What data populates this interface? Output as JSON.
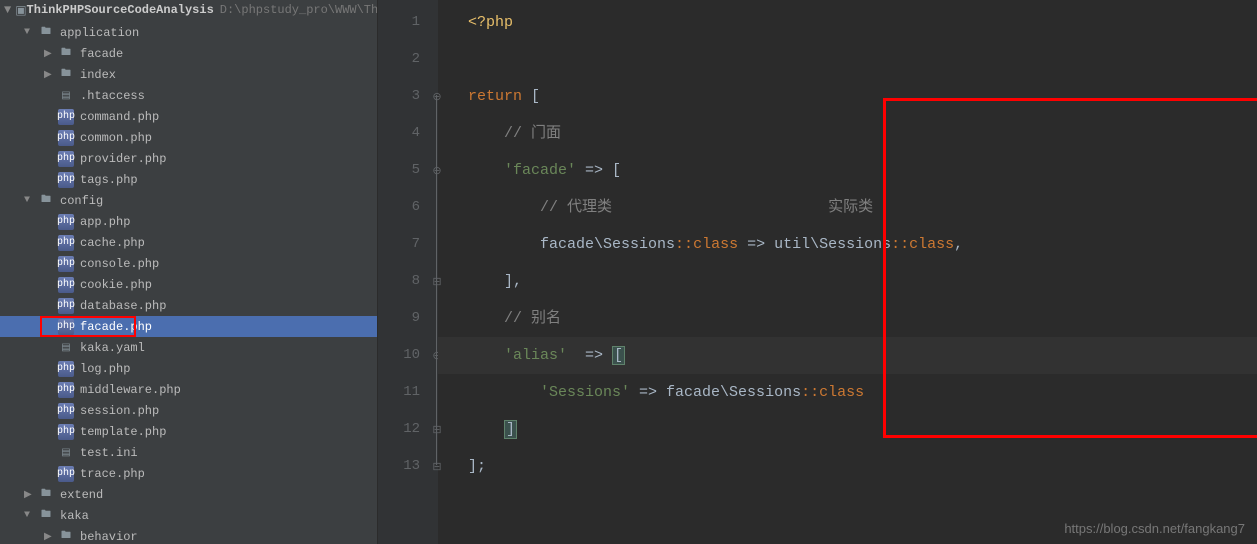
{
  "project": {
    "name": "ThinkPHPSourceCodeAnalysis",
    "path": "D:\\phpstudy_pro\\WWW\\Th"
  },
  "tree": [
    {
      "label": "application",
      "type": "folder",
      "indent": 1,
      "arrow": "▼"
    },
    {
      "label": "facade",
      "type": "folder",
      "indent": 2,
      "arrow": "▶"
    },
    {
      "label": "index",
      "type": "folder",
      "indent": 2,
      "arrow": "▶"
    },
    {
      "label": ".htaccess",
      "type": "file",
      "indent": 2,
      "arrow": ""
    },
    {
      "label": "command.php",
      "type": "php",
      "indent": 2,
      "arrow": ""
    },
    {
      "label": "common.php",
      "type": "php",
      "indent": 2,
      "arrow": ""
    },
    {
      "label": "provider.php",
      "type": "php",
      "indent": 2,
      "arrow": ""
    },
    {
      "label": "tags.php",
      "type": "php",
      "indent": 2,
      "arrow": ""
    },
    {
      "label": "config",
      "type": "folder",
      "indent": 1,
      "arrow": "▼"
    },
    {
      "label": "app.php",
      "type": "php",
      "indent": 2,
      "arrow": ""
    },
    {
      "label": "cache.php",
      "type": "php",
      "indent": 2,
      "arrow": ""
    },
    {
      "label": "console.php",
      "type": "php",
      "indent": 2,
      "arrow": ""
    },
    {
      "label": "cookie.php",
      "type": "php",
      "indent": 2,
      "arrow": ""
    },
    {
      "label": "database.php",
      "type": "php",
      "indent": 2,
      "arrow": ""
    },
    {
      "label": "facade.php",
      "type": "php",
      "indent": 2,
      "arrow": "",
      "selected": true,
      "redbox": true
    },
    {
      "label": "kaka.yaml",
      "type": "yaml",
      "indent": 2,
      "arrow": ""
    },
    {
      "label": "log.php",
      "type": "php",
      "indent": 2,
      "arrow": ""
    },
    {
      "label": "middleware.php",
      "type": "php",
      "indent": 2,
      "arrow": ""
    },
    {
      "label": "session.php",
      "type": "php",
      "indent": 2,
      "arrow": ""
    },
    {
      "label": "template.php",
      "type": "php",
      "indent": 2,
      "arrow": ""
    },
    {
      "label": "test.ini",
      "type": "file",
      "indent": 2,
      "arrow": ""
    },
    {
      "label": "trace.php",
      "type": "php",
      "indent": 2,
      "arrow": ""
    },
    {
      "label": "extend",
      "type": "folder",
      "indent": 1,
      "arrow": "▶"
    },
    {
      "label": "kaka",
      "type": "folder",
      "indent": 1,
      "arrow": "▼"
    },
    {
      "label": "behavior",
      "type": "folder",
      "indent": 2,
      "arrow": "▶"
    }
  ],
  "gutter": [
    "1",
    "2",
    "3",
    "4",
    "5",
    "6",
    "7",
    "8",
    "9",
    "10",
    "11",
    "12",
    "13"
  ],
  "code": {
    "l1_open": "<?php",
    "l3_return": "return",
    "l3_bracket": " [",
    "l4_comment": "// 门面",
    "l5_key": "'facade'",
    "l5_arrow": " => [",
    "l6_comment1": "// 代理类",
    "l6_comment2": "实际类",
    "l7_left": "facade\\Sessions",
    "l7_dcolon": "::",
    "l7_class": "class",
    "l7_arrow": " => ",
    "l7_right": "util\\Sessions",
    "l7_comma": ",",
    "l8_close": "],",
    "l9_comment": "// 别名",
    "l10_key": "'alias'",
    "l10_arrow": "  => ",
    "l10_bracket": "[",
    "l11_key": "'Sessions'",
    "l11_arrow": " => ",
    "l11_val": "facade\\Sessions",
    "l12_bracket": "]",
    "l13_close": "];"
  },
  "watermark": "https://blog.csdn.net/fangkang7"
}
